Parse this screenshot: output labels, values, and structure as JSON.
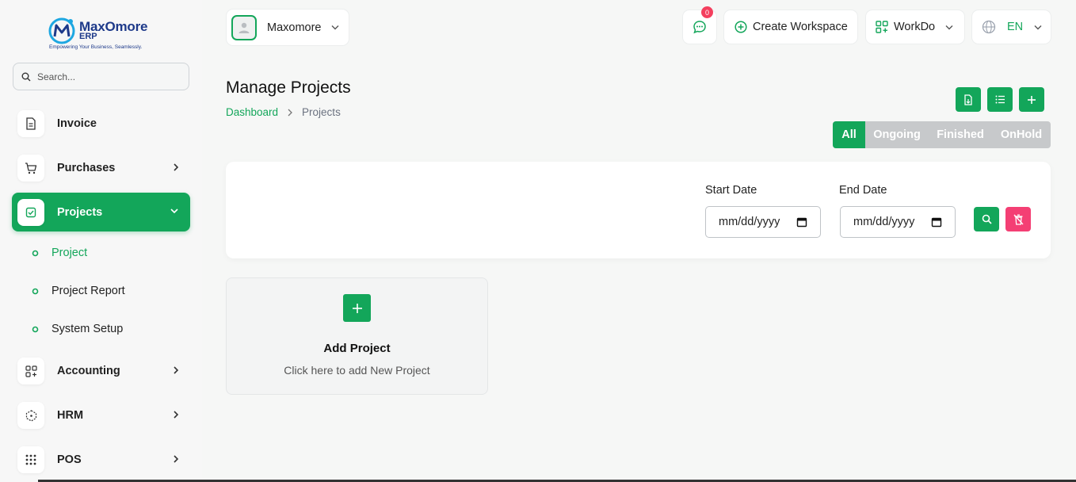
{
  "brand": {
    "name": "MaxOmore",
    "sub": "ERP",
    "tagline": "Empowering Your Business, Seamlessly.",
    "accent": "#13a65a"
  },
  "search": {
    "placeholder": "Search..."
  },
  "sidebar": {
    "items": [
      {
        "label": "Invoice",
        "icon": "invoice-icon"
      },
      {
        "label": "Purchases",
        "icon": "cart-icon"
      },
      {
        "label": "Projects",
        "icon": "check-square-icon"
      },
      {
        "label": "Accounting",
        "icon": "grid-plus-icon"
      },
      {
        "label": "HRM",
        "icon": "cube-icon"
      },
      {
        "label": "POS",
        "icon": "dots-grid-icon"
      }
    ],
    "subitems": [
      {
        "label": "Project"
      },
      {
        "label": "Project Report"
      },
      {
        "label": "System Setup"
      }
    ]
  },
  "topbar": {
    "user": "Maxomore",
    "notifications": "0",
    "create_workspace": "Create Workspace",
    "workspace": "WorkDo",
    "language": "EN"
  },
  "page": {
    "title": "Manage Projects",
    "breadcrumb": {
      "home": "Dashboard",
      "current": "Projects"
    }
  },
  "filters": [
    "All",
    "Ongoing",
    "Finished",
    "OnHold"
  ],
  "date_filter": {
    "start_label": "Start Date",
    "end_label": "End Date",
    "start_value": "mm/dd/yyyy",
    "end_value": "mm/dd/yyyy"
  },
  "add_card": {
    "title": "Add Project",
    "subtitle": "Click here to add New Project"
  }
}
